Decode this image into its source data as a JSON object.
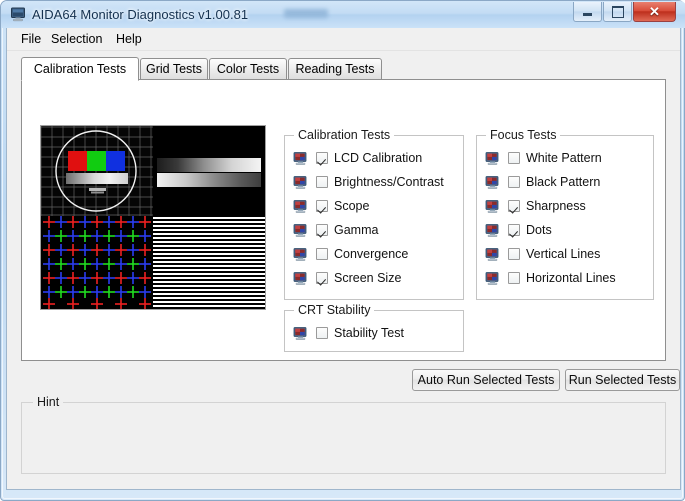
{
  "window": {
    "title": "AIDA64 Monitor Diagnostics v1.00.81",
    "icon": "monitor-icon",
    "buttons": {
      "minimize": "minimize-icon",
      "maximize": "maximize-icon",
      "close": "✕"
    }
  },
  "menubar": {
    "items": [
      {
        "label": "File"
      },
      {
        "label": "Selection"
      },
      {
        "label": "Help"
      }
    ]
  },
  "tabs": [
    {
      "label": "Calibration Tests",
      "active": true
    },
    {
      "label": "Grid Tests",
      "active": false
    },
    {
      "label": "Color Tests",
      "active": false
    },
    {
      "label": "Reading Tests",
      "active": false
    }
  ],
  "preview": {
    "name": "test-pattern-preview",
    "quadrants": [
      "grid-circle-rgb-bars",
      "grayscale-gradient-bars",
      "rgb-convergence-crosses",
      "horizontal-line-pattern"
    ]
  },
  "groups": {
    "calibration": {
      "title": "Calibration Tests",
      "items": [
        {
          "label": "LCD Calibration",
          "checked": true
        },
        {
          "label": "Brightness/Contrast",
          "checked": false
        },
        {
          "label": "Scope",
          "checked": true
        },
        {
          "label": "Gamma",
          "checked": true
        },
        {
          "label": "Convergence",
          "checked": false
        },
        {
          "label": "Screen Size",
          "checked": true
        }
      ]
    },
    "focus": {
      "title": "Focus Tests",
      "items": [
        {
          "label": "White Pattern",
          "checked": false
        },
        {
          "label": "Black Pattern",
          "checked": false
        },
        {
          "label": "Sharpness",
          "checked": true
        },
        {
          "label": "Dots",
          "checked": true
        },
        {
          "label": "Vertical Lines",
          "checked": false
        },
        {
          "label": "Horizontal Lines",
          "checked": false
        }
      ]
    },
    "crt": {
      "title": "CRT Stability",
      "items": [
        {
          "label": "Stability Test",
          "checked": false
        }
      ]
    }
  },
  "actions": {
    "auto_run": "Auto Run Selected Tests",
    "run": "Run Selected Tests"
  },
  "hint": {
    "title": "Hint",
    "text": ""
  },
  "colors": {
    "titlebar": "#c3dcf4",
    "close_button": "#d84b37",
    "client_bg": "#f0f0f0",
    "tabpage_bg": "#ffffff",
    "group_border": "#c4c4c4"
  }
}
